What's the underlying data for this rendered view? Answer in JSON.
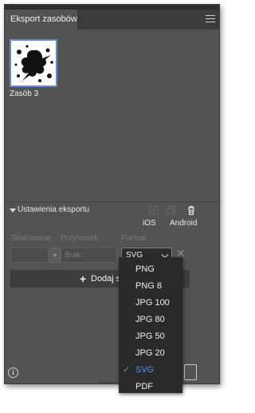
{
  "panel": {
    "tab_title": "Eksport zasobów",
    "menu_icon": "hamburger-menu-icon"
  },
  "assets": {
    "items": [
      {
        "name": "Zasób 3",
        "thumbnail_icon": "ink-splat-image"
      }
    ]
  },
  "export_settings": {
    "header_label": "Ustawienia eksportu",
    "icons": [
      "add-asset-icon",
      "duplicate-icon",
      "trash-icon"
    ],
    "platforms": {
      "ios": "iOS",
      "android": "Android"
    },
    "columns": {
      "scale": "Skalowanie",
      "suffix": "Przyrostek",
      "format": "Format"
    },
    "row": {
      "scale_value": "",
      "suffix_placeholder": "Brak",
      "format_value": "SVG"
    },
    "add_scale_label": "Dodaj ska"
  },
  "format_dropdown": {
    "options": [
      "PNG",
      "PNG 8",
      "JPG 100",
      "JPG 80",
      "JPG 50",
      "JPG 20",
      "SVG",
      "PDF"
    ],
    "selected": "SVG",
    "accent_color": "#4e95e8"
  },
  "colors": {
    "panel_bg": "#535353",
    "selection_border": "#5b8dd9"
  }
}
